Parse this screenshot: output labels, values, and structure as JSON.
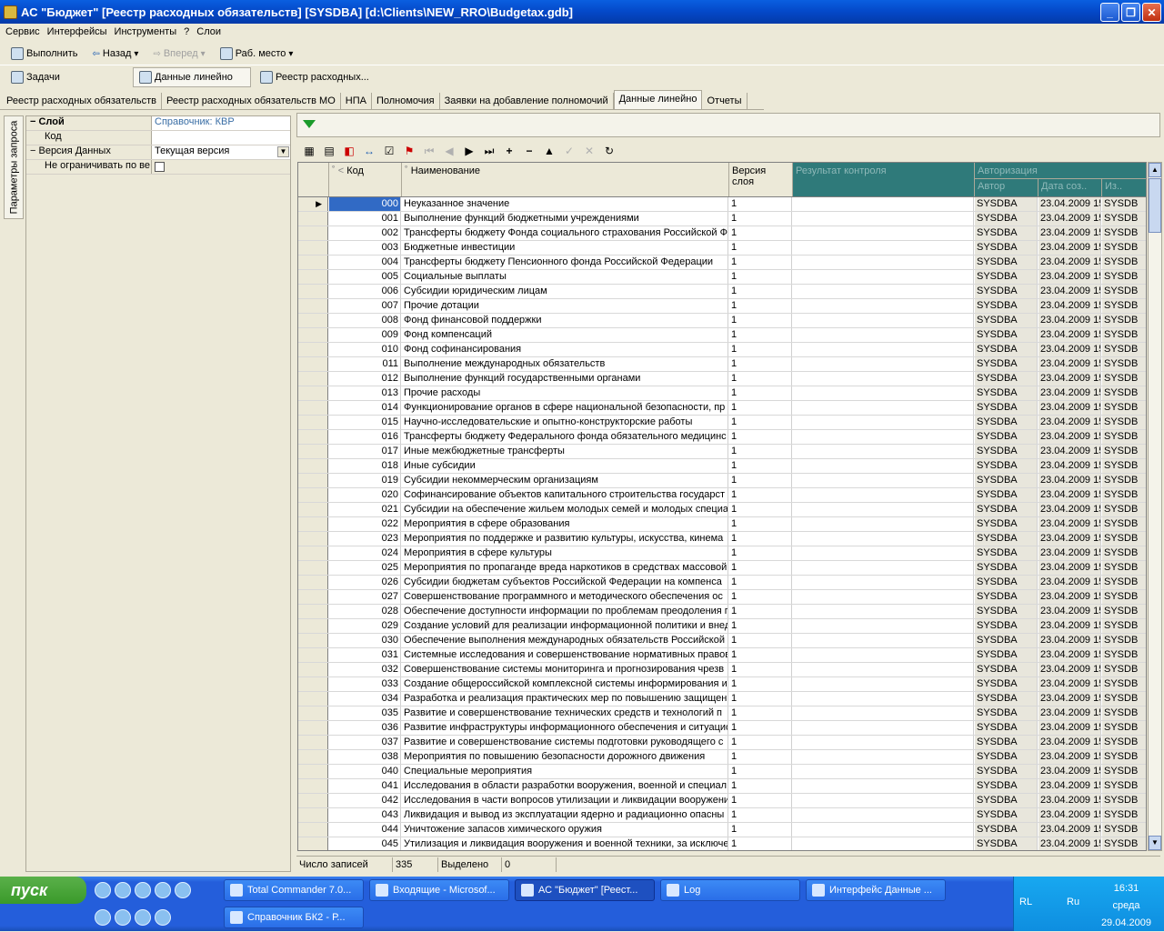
{
  "window": {
    "title": "АС \"Бюджет\" [Реестр расходных обязательств] [SYSDBA] [d:\\Clients\\NEW_RRO\\Budgetax.gdb]"
  },
  "menu": [
    "Сервис",
    "Интерфейсы",
    "Инструменты",
    "?",
    "Слои"
  ],
  "toolbar1": {
    "run": "Выполнить",
    "back": "Назад",
    "forward": "Вперед",
    "workplace": "Раб. место"
  },
  "toolbar2": {
    "tasks": "Задачи",
    "linear": "Данные линейно",
    "registry": "Реестр расходных..."
  },
  "tabs": [
    "Реестр расходных обязательств",
    "Реестр расходных обязательств МО",
    "НПА",
    "Полномочия",
    "Заявки на добавление полномочий",
    "Данные линейно",
    "Отчеты"
  ],
  "side_tab": "Параметры запроса",
  "params": {
    "layer_label": "Слой",
    "layer_value": "Справочник: КВР",
    "code_label": "Код",
    "version_label": "Версия Данных",
    "version_value": "Текущая версия",
    "nolimit_label": "Не ограничивать по ве"
  },
  "grid": {
    "headers": {
      "code": "Код",
      "name": "Наименование",
      "version": "Версия слоя",
      "result": "Результат контроля",
      "auth": "Авторизация",
      "author": "Автор",
      "created": "Дата соз..",
      "iz": "Из.."
    },
    "rows": [
      [
        "000",
        "Неуказанное значение"
      ],
      [
        "001",
        "Выполнение функций бюджетными учреждениями"
      ],
      [
        "002",
        "Трансферты бюджету Фонда социального страхования Российской Ф"
      ],
      [
        "003",
        "Бюджетные инвестиции"
      ],
      [
        "004",
        "Трансферты бюджету Пенсионного фонда Российской Федерации"
      ],
      [
        "005",
        "Социальные выплаты"
      ],
      [
        "006",
        "Субсидии юридическим лицам"
      ],
      [
        "007",
        "Прочие дотации"
      ],
      [
        "008",
        "Фонд финансовой поддержки"
      ],
      [
        "009",
        "Фонд компенсаций"
      ],
      [
        "010",
        "Фонд софинансирования"
      ],
      [
        "011",
        "Выполнение международных обязательств"
      ],
      [
        "012",
        "Выполнение функций государственными органами"
      ],
      [
        "013",
        "Прочие расходы"
      ],
      [
        "014",
        "Функционирование органов в сфере национальной безопасности, пр"
      ],
      [
        "015",
        "Научно-исследовательские и опытно-конструкторские работы"
      ],
      [
        "016",
        "Трансферты бюджету Федерального фонда обязательного медицинс"
      ],
      [
        "017",
        "Иные межбюджетные трансферты"
      ],
      [
        "018",
        "Иные субсидии"
      ],
      [
        "019",
        "Субсидии некоммерческим организациям"
      ],
      [
        "020",
        "Софинансирование объектов капитального строительства государст"
      ],
      [
        "021",
        "Субсидии на обеспечение жильем молодых семей и молодых специа"
      ],
      [
        "022",
        "Мероприятия в сфере образования"
      ],
      [
        "023",
        "Мероприятия по поддержке и развитию культуры, искусства, кинема"
      ],
      [
        "024",
        "Мероприятия в сфере культуры"
      ],
      [
        "025",
        "Мероприятия по пропаганде вреда наркотиков в средствах массовой"
      ],
      [
        "026",
        "Субсидии бюджетам субъектов Российской Федерации на компенса"
      ],
      [
        "027",
        "Совершенствование программного и методического обеспечения ос"
      ],
      [
        "028",
        "Обеспечение доступности информации по проблемам преодоления п"
      ],
      [
        "029",
        "Создание условий для реализации информационной политики и внед"
      ],
      [
        "030",
        "Обеспечение выполнения международных обязательств Российской"
      ],
      [
        "031",
        "Системные исследования и совершенствование нормативных правов"
      ],
      [
        "032",
        "Совершенствование системы мониторинга и прогнозирования чрезв"
      ],
      [
        "033",
        "Создание общероссийской комплексной системы информирования и"
      ],
      [
        "034",
        "Разработка и реализация практических мер по повышению защищен"
      ],
      [
        "035",
        "Развитие и совершенствование технических средств и технологий п"
      ],
      [
        "036",
        "Развитие инфраструктуры информационного обеспечения и ситуацио"
      ],
      [
        "037",
        "Развитие и совершенствование системы подготовки руководящего с"
      ],
      [
        "038",
        "Мероприятия по повышению безопасности дорожного движения"
      ],
      [
        "040",
        "Специальные мероприятия"
      ],
      [
        "041",
        "Исследования в области разработки вооружения, военной и специал"
      ],
      [
        "042",
        "Исследования в части вопросов утилизации и ликвидации вооружени"
      ],
      [
        "043",
        "Ликвидация и вывод из эксплуатации ядерно и радиационно опасны"
      ],
      [
        "044",
        "Уничтожение запасов химического оружия"
      ],
      [
        "045",
        "Утилизация и ликвидация вооружения и военной техники, за исключе"
      ]
    ],
    "version_value": "1",
    "author_value": "SYSDBA",
    "date_value": "23.04.2009 15",
    "iz_value": "SYSDB"
  },
  "status": {
    "count_label": "Число записей",
    "count_value": "335",
    "selected_label": "Выделено",
    "selected_value": "0"
  },
  "taskbar": {
    "start": "пуск",
    "tasks": [
      "Total Commander 7.0...",
      "Входящие - Microsof...",
      "АС \"Бюджет\" [Реест...",
      "Log",
      "Интерфейс Данные ...",
      "Справочник БК2 - Р..."
    ],
    "lang": "RL",
    "tray_lang": "Ru",
    "time": "16:31",
    "day": "среда",
    "date": "29.04.2009"
  }
}
